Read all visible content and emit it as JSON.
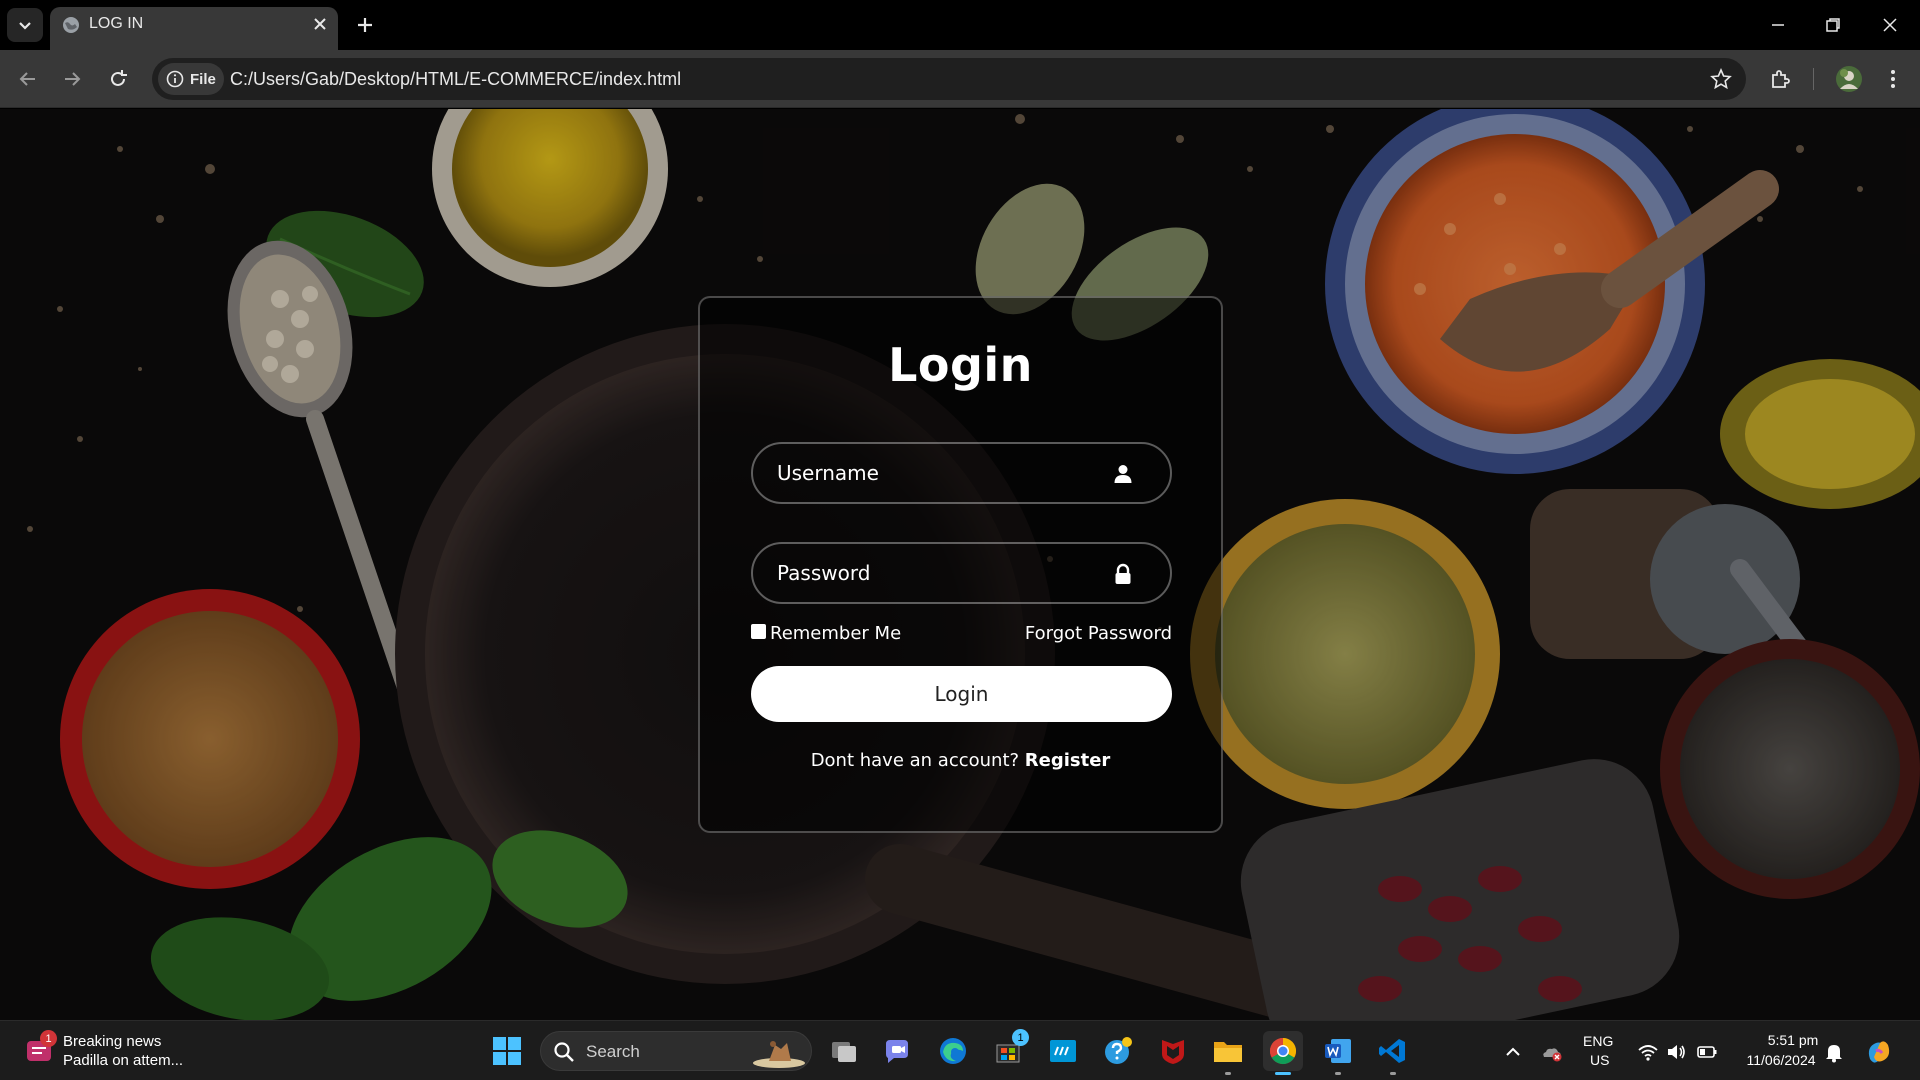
{
  "browser": {
    "tab_title": "LOG IN",
    "site_chip_label": "File",
    "url": "C:/Users/Gab/Desktop/HTML/E-COMMERCE/index.html"
  },
  "login": {
    "title": "Login",
    "username_placeholder": "Username",
    "password_placeholder": "Password",
    "remember_label": "Remember Me",
    "forgot_label": "Forgot Password",
    "submit_label": "Login",
    "register_prompt": "Dont have an account? ",
    "register_link": "Register"
  },
  "taskbar": {
    "news_title": "Breaking news",
    "news_subtitle": "Padilla on attem...",
    "news_badge": "1",
    "search_placeholder": "Search",
    "store_badge": "1",
    "lang_primary": "ENG",
    "lang_secondary": "US",
    "time": "5:51 pm",
    "date": "11/06/2024"
  },
  "colors": {
    "chrome_bg": "#000000",
    "toolbar_bg": "#383838",
    "omnibox_bg": "#1f1f1f",
    "card_border": "rgba(255,255,255,0.28)",
    "button_bg": "#ffffff",
    "taskbar_bg": "#1c1c1c",
    "accent": "#4cc2ff"
  },
  "icons": {
    "tab_menu": "chevron-down-icon",
    "tab_favicon": "globe-icon",
    "tab_close": "close-icon",
    "new_tab": "plus-icon",
    "back": "arrow-left-icon",
    "forward": "arrow-right-icon",
    "reload": "reload-icon",
    "site_info": "info-icon",
    "bookmark": "star-icon",
    "extensions": "puzzle-icon",
    "profile": "avatar-icon",
    "menu": "kebab-menu-icon",
    "username": "user-icon",
    "password": "lock-icon"
  }
}
